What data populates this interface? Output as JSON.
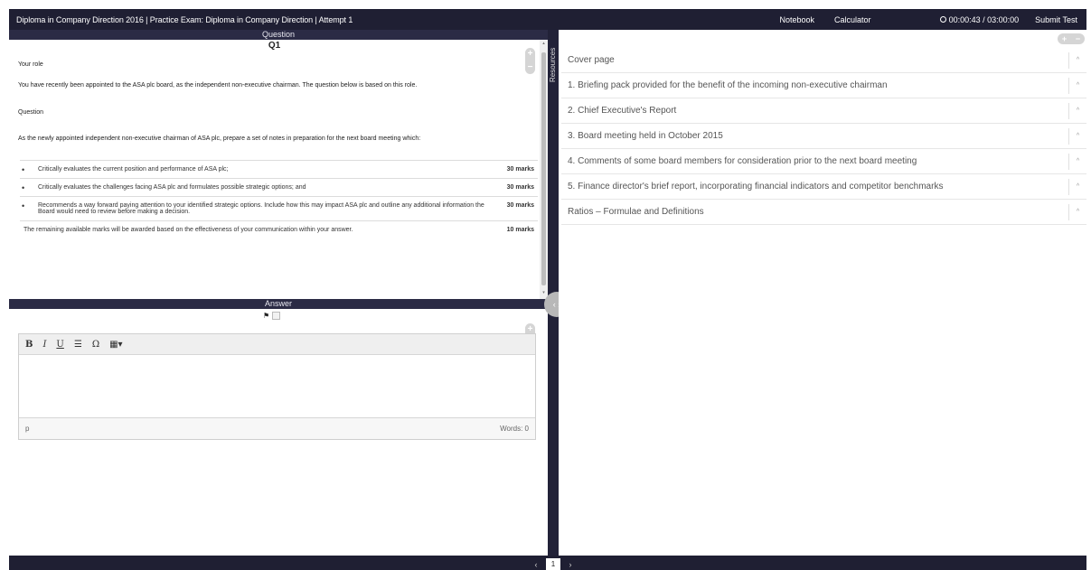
{
  "header": {
    "title": "Diploma in Company Direction 2016 | Practice Exam: Diploma in Company Direction | Attempt 1",
    "notebook_label": "Notebook",
    "calculator_label": "Calculator",
    "timer": "00:00:43 / 03:00:00",
    "submit_label": "Submit Test"
  },
  "question": {
    "panel_title": "Question",
    "number": "Q1",
    "role_heading": "Your role",
    "role_text": "You have recently been appointed to the ASA plc board, as the independent non-executive chairman. The question below is based on this role.",
    "question_heading": "Question",
    "intro": "As the newly appointed independent non-executive chairman of ASA plc, prepare a set of notes in preparation for the next board meeting which:",
    "items": [
      {
        "text": "Critically evaluates the current position and performance of ASA plc;",
        "marks": "30 marks"
      },
      {
        "text": "Critically evaluates the challenges facing ASA plc and formulates possible strategic options; and",
        "marks": "30 marks"
      },
      {
        "text": "Recommends a way forward paying attention to your identified strategic options. Include how this may impact ASA plc and outline any additional information the Board would need to review before making a decision.",
        "marks": "30 marks"
      }
    ],
    "remaining": {
      "text": "The remaining available marks will be awarded based on the effectiveness of your communication within your answer.",
      "marks": "10 marks"
    }
  },
  "answer": {
    "panel_title": "Answer",
    "toolbar": {
      "bold": "B",
      "italic": "I",
      "underline": "U",
      "list": "☰",
      "omega": "Ω",
      "table": "▦▾"
    },
    "status_tag": "p",
    "word_count": "Words: 0"
  },
  "resources": {
    "label": "Resources",
    "items": [
      "Cover page",
      "1. Briefing pack provided for the benefit of the incoming non-executive chairman",
      "2. Chief Executive's Report",
      "3. Board meeting held in October 2015",
      "4. Comments of some board members for consideration prior to the next board meeting",
      "5. Finance director's brief report, incorporating financial indicators and competitor benchmarks",
      "Ratios – Formulae and Definitions"
    ]
  },
  "pager": {
    "prev": "‹",
    "current": "1",
    "next": "›"
  },
  "icons": {
    "zoom_plus": "+",
    "zoom_minus": "−",
    "chevron_up": "^",
    "collapse": "‹ ›",
    "flag": "⚑",
    "scroll_up": "▴",
    "scroll_down": "▾"
  },
  "colors": {
    "header_bg": "#1f1f33",
    "panel_header_bg": "#2b2b45"
  }
}
